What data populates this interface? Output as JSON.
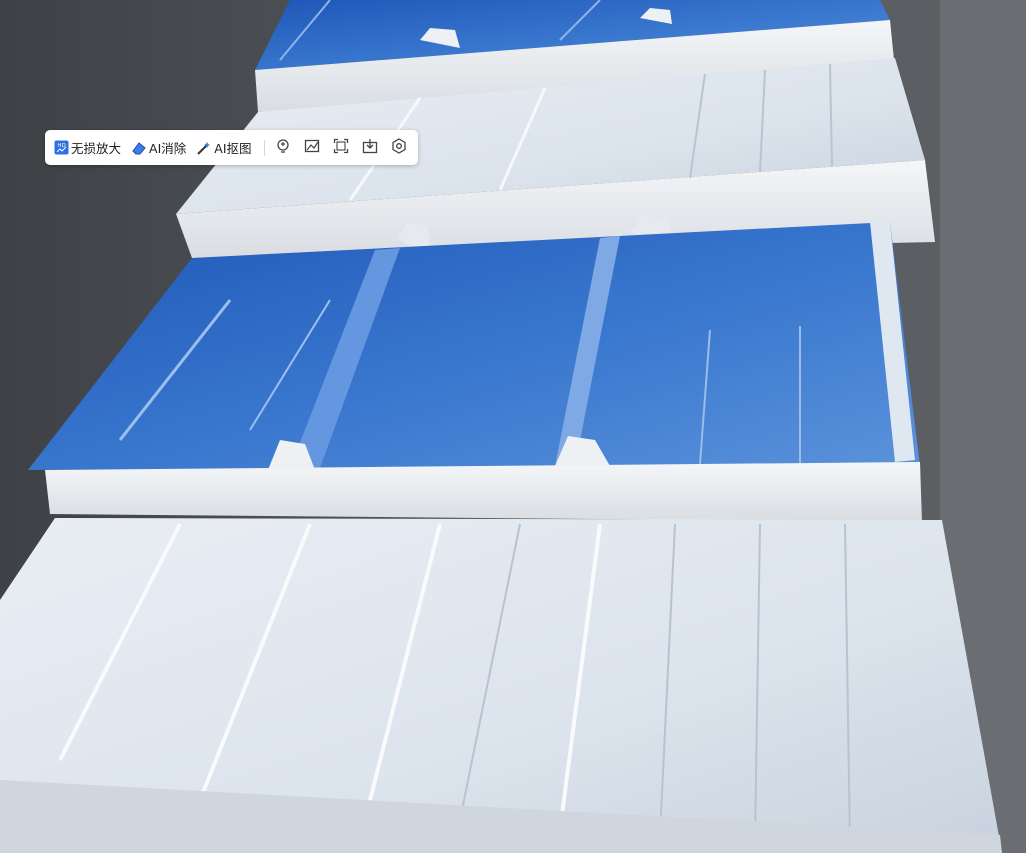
{
  "toolbar": {
    "items": [
      {
        "label": "无损放大",
        "icon": "hd-upscale-icon"
      },
      {
        "label": "AI消除",
        "icon": "eraser-icon"
      },
      {
        "label": "AI抠图",
        "icon": "magic-wand-icon"
      }
    ],
    "actions": [
      {
        "icon": "bulb-icon"
      },
      {
        "icon": "image-edit-icon"
      },
      {
        "icon": "crop-icon"
      },
      {
        "icon": "download-icon"
      },
      {
        "icon": "settings-icon"
      }
    ]
  },
  "colors": {
    "panel_blue": "#2f67c2",
    "panel_white": "#dfe6ee",
    "foam": "#eceff2",
    "background": "#4f5256"
  }
}
